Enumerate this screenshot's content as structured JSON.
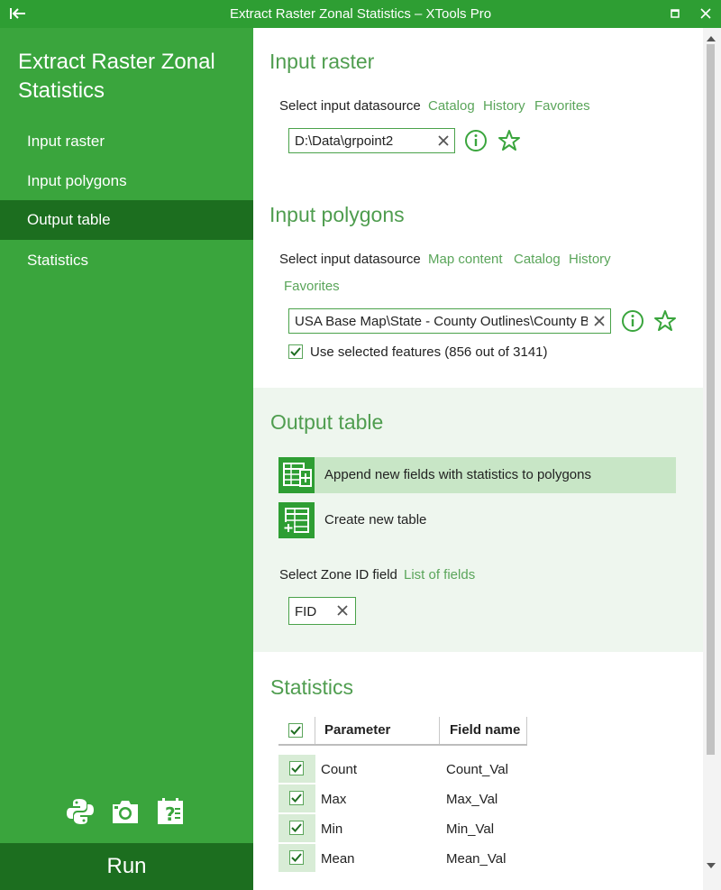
{
  "window": {
    "title": "Extract Raster Zonal Statistics – XTools Pro",
    "back_icon": "collapse-left-icon",
    "maximize_icon": "maximize-icon",
    "close_icon": "close-icon"
  },
  "sidebar": {
    "title": "Extract Raster Zonal Statistics",
    "items": [
      {
        "label": "Input raster",
        "active": false
      },
      {
        "label": "Input polygons",
        "active": false
      },
      {
        "label": "Output table",
        "active": true
      },
      {
        "label": "Statistics",
        "active": false
      }
    ],
    "tools": [
      "python-icon",
      "camera-icon",
      "help-icon"
    ],
    "run_label": "Run"
  },
  "input_raster": {
    "title": "Input raster",
    "select_label": "Select input datasource",
    "links": [
      "Catalog",
      "History",
      "Favorites"
    ],
    "value": "D:\\Data\\grpoint2"
  },
  "input_polygons": {
    "title": "Input polygons",
    "select_label": "Select input datasource",
    "links": [
      "Map content",
      "Catalog",
      "History",
      "Favorites"
    ],
    "value": "USA Base Map\\State - County Outlines\\County Bo",
    "use_selected_label": "Use selected features (856 out of 3141)",
    "use_selected_checked": true
  },
  "output_table": {
    "title": "Output table",
    "options": [
      {
        "label": "Append new fields with statistics to polygons",
        "selected": true
      },
      {
        "label": "Create new table",
        "selected": false
      }
    ],
    "zone_label": "Select Zone ID field",
    "zone_link": "List of fields",
    "zone_value": "FID"
  },
  "statistics": {
    "title": "Statistics",
    "columns": [
      "Parameter",
      "Field name"
    ],
    "rows": [
      {
        "parameter": "Count",
        "field": "Count_Val",
        "checked": true
      },
      {
        "parameter": "Max",
        "field": "Max_Val",
        "checked": true
      },
      {
        "parameter": "Min",
        "field": "Min_Val",
        "checked": true
      },
      {
        "parameter": "Mean",
        "field": "Mean_Val",
        "checked": true
      }
    ]
  },
  "colors": {
    "brand": "#2e9e33",
    "sidebar": "#3aa53d",
    "sidebar_active": "#1c6e1f",
    "section_title": "#4f9d4f",
    "link": "#5aa55a"
  }
}
